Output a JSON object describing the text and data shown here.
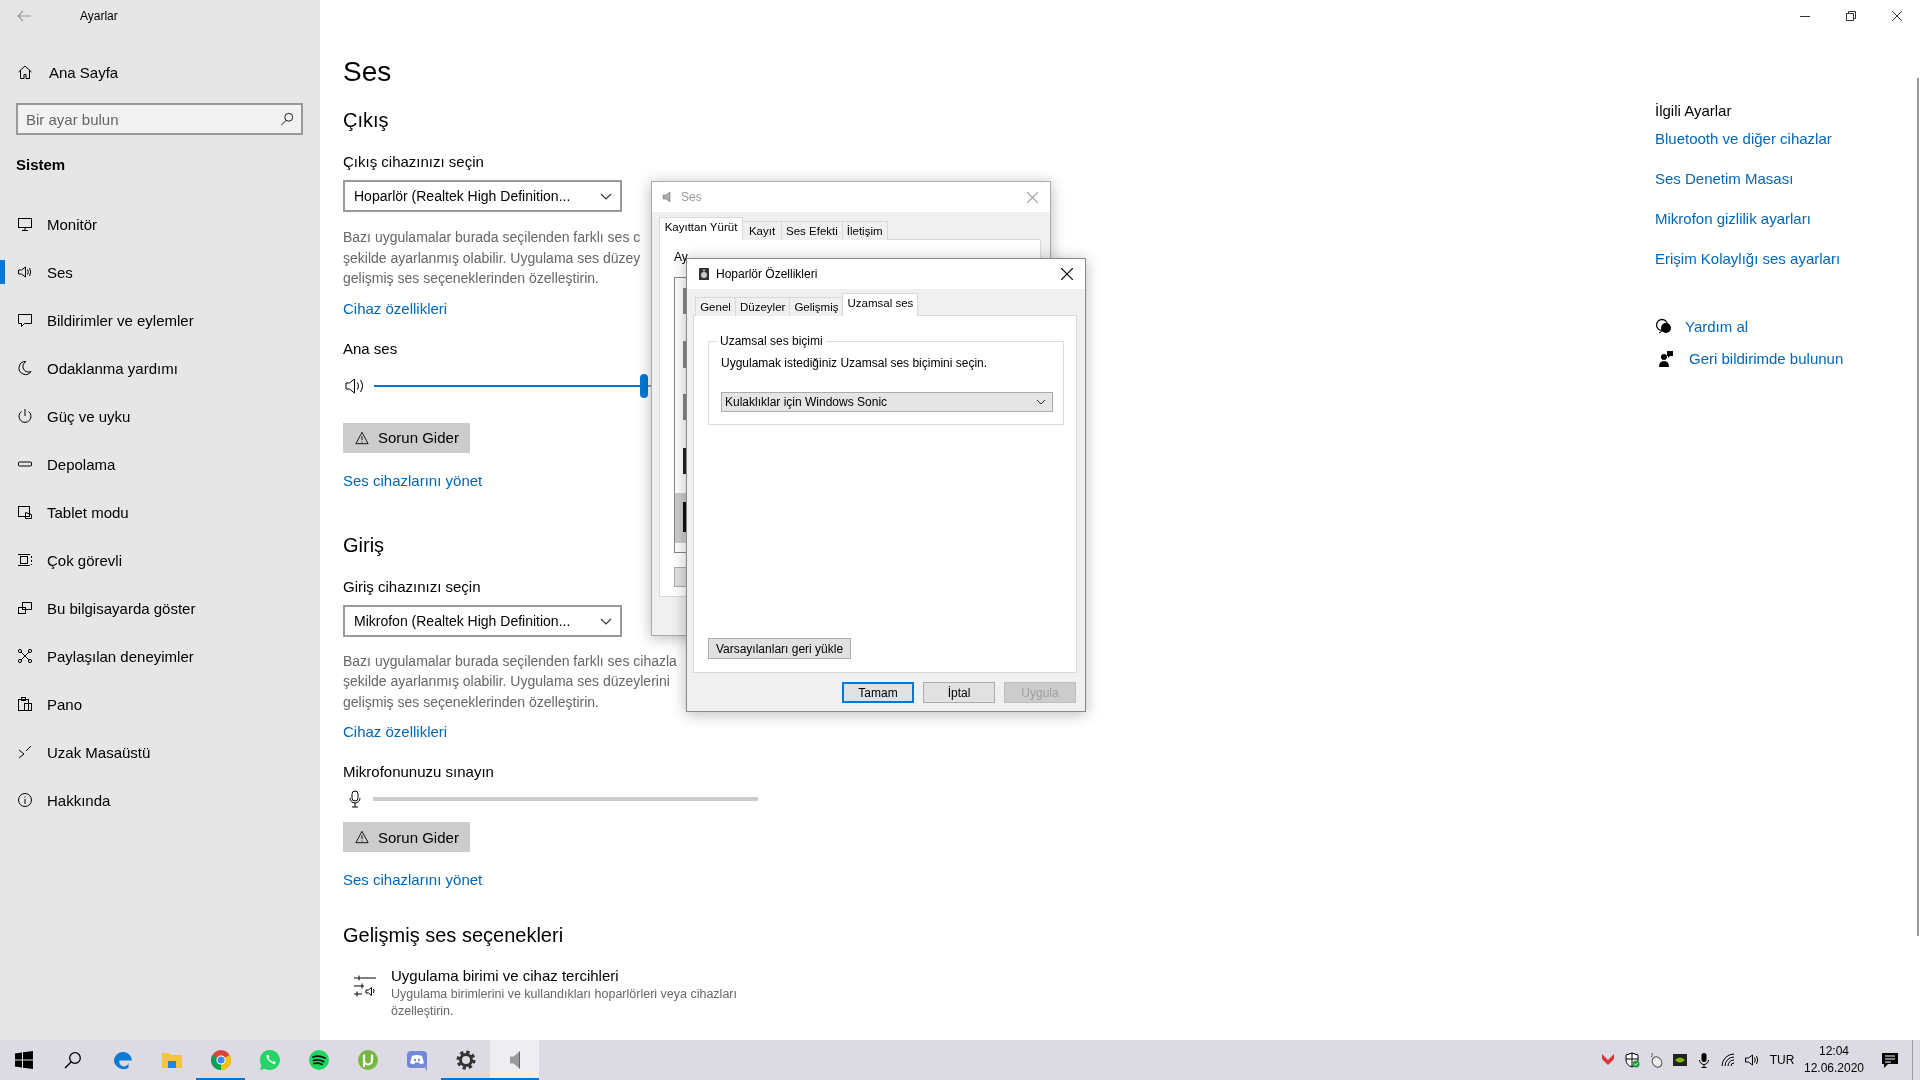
{
  "settings": {
    "title": "Ayarlar"
  },
  "sidebar": {
    "home": "Ana Sayfa",
    "search": {
      "placeholder": "Bir ayar bulun"
    },
    "section": "Sistem",
    "items": [
      {
        "label": "Monitör",
        "selected": false
      },
      {
        "label": "Ses",
        "selected": true
      },
      {
        "label": "Bildirimler ve eylemler",
        "selected": false
      },
      {
        "label": "Odaklanma yardımı",
        "selected": false
      },
      {
        "label": "Güç ve uyku",
        "selected": false
      },
      {
        "label": "Depolama",
        "selected": false
      },
      {
        "label": "Tablet modu",
        "selected": false
      },
      {
        "label": "Çok görevli",
        "selected": false
      },
      {
        "label": "Bu bilgisayarda göster",
        "selected": false
      },
      {
        "label": "Paylaşılan deneyimler",
        "selected": false
      },
      {
        "label": "Pano",
        "selected": false
      },
      {
        "label": "Uzak Masaüstü",
        "selected": false
      },
      {
        "label": "Hakkında",
        "selected": false
      }
    ]
  },
  "page": {
    "title": "Ses",
    "output": {
      "heading": "Çıkış",
      "device_label": "Çıkış cihazınızı seçin",
      "device": "Hoparlör (Realtek High Definition...",
      "description": [
        "Bazı uygulamalar burada seçilenden farklı ses c",
        "şekilde ayarlanmış olabilir. Uygulama ses düzey",
        "gelişmiş ses seçeneklerinden özelleştirin."
      ],
      "properties_link": "Cihaz özellikleri",
      "volume_label": "Ana ses",
      "volume": {
        "level": 0.7
      },
      "troubleshoot": "Sorun Gider",
      "manage_link": "Ses cihazlarını yönet"
    },
    "input": {
      "heading": "Giriş",
      "device_label": "Giriş cihazınızı seçin",
      "device": "Mikrofon (Realtek High Definition...",
      "description": [
        "Bazı uygulamalar burada seçilenden farklı ses cihazla",
        "şekilde ayarlanmış olabilir. Uygulama ses düzeylerini",
        "gelişmiş ses seçeneklerinden özelleştirin."
      ],
      "properties_link": "Cihaz özellikleri",
      "test_label": "Mikrofonunuzu sınayın",
      "mic_meter": {
        "level": 0
      },
      "troubleshoot": "Sorun Gider",
      "manage_link": "Ses cihazlarını yönet"
    },
    "advanced": {
      "heading": "Gelişmiş ses seçenekleri",
      "item_title": "Uygulama birimi ve cihaz tercihleri",
      "item_description": "Uygulama birimlerini ve kullandıkları hoparlörleri veya cihazları özelleştirin."
    }
  },
  "related": {
    "heading": "İlgili Ayarlar",
    "links": [
      "Bluetooth ve diğer cihazlar",
      "Ses Denetim Masası",
      "Mikrofon gizlilik ayarları",
      "Erişim Kolaylığı ses ayarları"
    ],
    "help": [
      "Yardım al",
      "Geri bildirimde bulunun"
    ]
  },
  "sound_dialog": {
    "title": "Ses",
    "tabs": [
      {
        "label": "Kayıttan Yürüt",
        "selected": true
      },
      {
        "label": "Kayıt",
        "selected": false
      },
      {
        "label": "Ses Efekti",
        "selected": false
      },
      {
        "label": "İletişim",
        "selected": false
      }
    ],
    "instruction": "Ay"
  },
  "speaker_dialog": {
    "title": "Hoparlör Özellikleri",
    "tabs": [
      {
        "label": "Genel",
        "selected": false
      },
      {
        "label": "Düzeyler",
        "selected": false
      },
      {
        "label": "Gelişmiş",
        "selected": false
      },
      {
        "label": "Uzamsal ses",
        "selected": true
      }
    ],
    "group_title": "Uzamsal ses biçimi",
    "prompt": "Uygulamak istediğiniz Uzamsal ses biçimini seçin.",
    "format": "Kulaklıklar için Windows Sonic",
    "restore_button": "Varsayılanları geri yükle",
    "buttons": [
      {
        "label": "Tamam",
        "default": true,
        "disabled": false
      },
      {
        "label": "İptal",
        "default": false,
        "disabled": false
      },
      {
        "label": "Uygula",
        "default": false,
        "disabled": true
      }
    ]
  },
  "taskbar": {
    "apps": [
      {
        "running": false,
        "active": false
      },
      {
        "running": false,
        "active": false
      },
      {
        "running": true,
        "active": false
      },
      {
        "running": false,
        "active": false
      },
      {
        "running": false,
        "active": false
      },
      {
        "running": false,
        "active": false
      },
      {
        "running": false,
        "active": false
      },
      {
        "running": true,
        "active": false
      },
      {
        "running": true,
        "active": true
      }
    ],
    "tray": {
      "language": "TUR",
      "time": "12:04",
      "date": "12.06.2020"
    }
  }
}
